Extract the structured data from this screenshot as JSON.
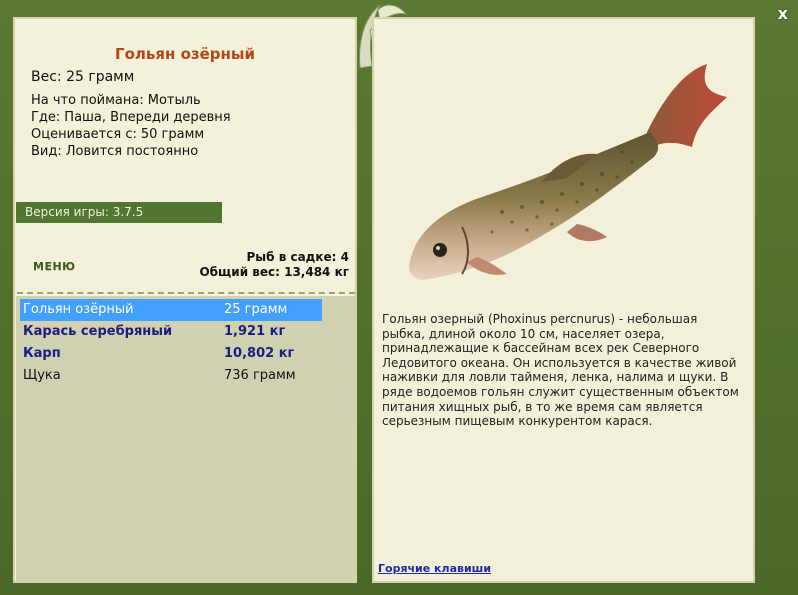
{
  "card": {
    "title": "Гольян озёрный",
    "weight": "Вес: 25 грамм",
    "info": [
      {
        "label": "На что поймана:",
        "value": "Мотыль"
      },
      {
        "label": "Где:",
        "value": "Паша, Впереди деревня"
      },
      {
        "label": "Оценивается с:",
        "value": "50 грамм"
      },
      {
        "label": "Вид:",
        "value": "Ловится постоянно"
      }
    ]
  },
  "version": "Версия игры: 3.7.5",
  "menu_label": "МЕНЮ",
  "stats": {
    "fish_in_cage": "Рыб в садке: 4",
    "total_weight": "Общий вес: 13,484 кг"
  },
  "fish_list": [
    {
      "name": "Гольян озёрный",
      "weight": "25 грамм",
      "state": "selected"
    },
    {
      "name": "Карась серебряный",
      "weight": "1,921 кг",
      "state": "bold"
    },
    {
      "name": "Карп",
      "weight": "10,802 кг",
      "state": "bold"
    },
    {
      "name": "Щука",
      "weight": "736 грамм",
      "state": "normal"
    }
  ],
  "description": "Гольян озерный (Phoxinus percnurus) - небольшая рыбка, длиной около 10 см, населяет озера, принадлежащие к бассейнам всех рек Северного Ледовитого океана. Он используется в качестве живой наживки для ловли тайменя, ленка, налима и щуки. В ряде водоемов гольян служит существенным объектом питания хищных рыб, в то же время сам является серьезным пищевым конкурентом карася.",
  "hotkeys_label": "Горячие клавиши",
  "close_label": "x",
  "colors": {
    "frame": "#4c6a2a",
    "panel": "#f2f0d9",
    "title": "#b5451a",
    "selected": "#44a0ff",
    "bold_text": "#1c1c80"
  },
  "icons": [
    "close-icon",
    "leaf-logo-icon",
    "fish-image"
  ]
}
